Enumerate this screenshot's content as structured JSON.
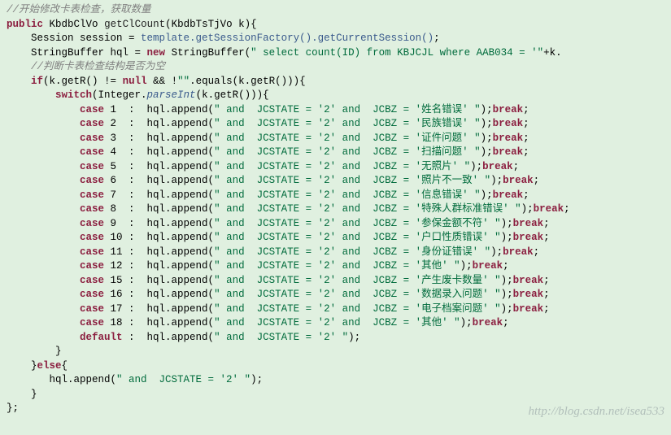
{
  "code": {
    "c1": "//开始修改卡表检查，获取数量",
    "kw_public": "public",
    "ret_type": "KbdbClVo",
    "method_name": "getClCount",
    "param_type": "KbdbTsTjVo",
    "param_name": "k",
    "sess_type": "Session",
    "sess_var": "session",
    "eq1": " = ",
    "template": "template",
    "dot": ".",
    "getSessionFactory": "getSessionFactory()",
    "getCurrentSession": "getCurrentSession()",
    "semi": ";",
    "sb_type": "StringBuffer",
    "sb_var": "hql",
    "kw_new": "new",
    "sb_ctor": "StringBuffer",
    "s_select": "\" select count(ID) from KBJCJL where AAB034 = '\"",
    "plus_k": "+k.",
    "c2": "//判断卡表检查结构是否为空",
    "kw_if": "if",
    "if_cond": "(k.getR() != ",
    "if_null": "null",
    "if_and": " && !",
    "if_empty": "\"\"",
    "if_tail": ".equals(k.getR())){",
    "kw_switch": "switch",
    "switch_open": "(Integer.",
    "parseInt": "parseInt",
    "switch_close": "(k.getR())){",
    "case_items": [
      {
        "n": "1",
        "pad": " ",
        "s": "\" and  JCSTATE = '2' and  JCBZ = '姓名错误' \""
      },
      {
        "n": "2",
        "pad": " ",
        "s": "\" and  JCSTATE = '2' and  JCBZ = '民族错误' \""
      },
      {
        "n": "3",
        "pad": " ",
        "s": "\" and  JCSTATE = '2' and  JCBZ = '证件问题' \""
      },
      {
        "n": "4",
        "pad": " ",
        "s": "\" and  JCSTATE = '2' and  JCBZ = '扫描问题' \""
      },
      {
        "n": "5",
        "pad": " ",
        "s": "\" and  JCSTATE = '2' and  JCBZ = '无照片' \""
      },
      {
        "n": "6",
        "pad": " ",
        "s": "\" and  JCSTATE = '2' and  JCBZ = '照片不一致' \""
      },
      {
        "n": "7",
        "pad": " ",
        "s": "\" and  JCSTATE = '2' and  JCBZ = '信息错误' \""
      },
      {
        "n": "8",
        "pad": " ",
        "s": "\" and  JCSTATE = '2' and  JCBZ = '特殊人群标准错误' \""
      },
      {
        "n": "9",
        "pad": " ",
        "s": "\" and  JCSTATE = '2' and  JCBZ = '参保金额不符' \""
      },
      {
        "n": "10",
        "pad": "",
        "s": "\" and  JCSTATE = '2' and  JCBZ = '户口性质错误' \""
      },
      {
        "n": "11",
        "pad": "",
        "s": "\" and  JCSTATE = '2' and  JCBZ = '身份证错误' \""
      },
      {
        "n": "12",
        "pad": "",
        "s": "\" and  JCSTATE = '2' and  JCBZ = '其他' \""
      },
      {
        "n": "15",
        "pad": "",
        "s": "\" and  JCSTATE = '2' and  JCBZ = '产生废卡数量' \""
      },
      {
        "n": "16",
        "pad": "",
        "s": "\" and  JCSTATE = '2' and  JCBZ = '数据录入问题' \""
      },
      {
        "n": "17",
        "pad": "",
        "s": "\" and  JCSTATE = '2' and  JCBZ = '电子档案问题' \""
      },
      {
        "n": "18",
        "pad": "",
        "s": "\" and  JCSTATE = '2' and  JCBZ = '其他' \""
      }
    ],
    "kw_case": "case",
    "kw_break": "break",
    "kw_default": "default",
    "default_s": "\" and  JCSTATE = '2' \"",
    "append": "hql.append(",
    "kw_else": "else",
    "else_open": "{",
    "else_body_s": "\" and  JCSTATE = '2' \"",
    "brace_close": "}",
    "end_brace_semi": "};"
  },
  "watermark": "http://blog.csdn.net/isea533"
}
